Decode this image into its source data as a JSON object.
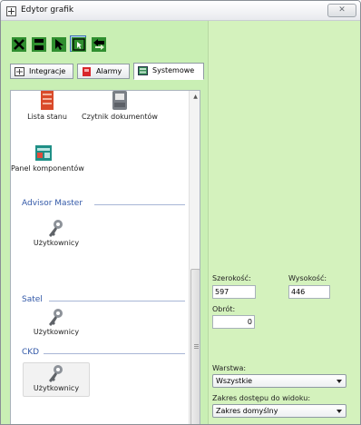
{
  "window": {
    "title": "Edytor grafik",
    "close_symbol": "✕"
  },
  "toolbar": {
    "buttons": [
      {
        "icon": "close-icon",
        "color": "#2f8f2f"
      },
      {
        "icon": "save-icon",
        "color": "#2f8f2f"
      },
      {
        "icon": "pointer-icon",
        "color": "#2f8f2f"
      },
      {
        "icon": "select-area-icon",
        "color": "#2f8f2f",
        "selected": true
      },
      {
        "icon": "swap-icon",
        "color": "#2f8f2f"
      }
    ]
  },
  "tabs": [
    {
      "label": "Integracje",
      "icon": "integration-icon"
    },
    {
      "label": "Alarmy",
      "icon": "alarm-icon"
    },
    {
      "label": "Systemowe",
      "icon": "system-icon",
      "active": true
    }
  ],
  "components": {
    "top_items": [
      {
        "label": "Lista stanu",
        "icon": "status-list-icon"
      },
      {
        "label": "Czytnik dokumentów",
        "icon": "document-reader-icon"
      },
      {
        "label": "Panel komponentów",
        "icon": "component-panel-icon"
      }
    ],
    "groups": [
      {
        "title": "Advisor Master",
        "items": [
          {
            "label": "Użytkownicy",
            "icon": "users-key-icon"
          }
        ]
      },
      {
        "title": "Satel",
        "items": [
          {
            "label": "Użytkownicy",
            "icon": "users-key-icon"
          }
        ]
      },
      {
        "title": "CKD",
        "items": [
          {
            "label": "Użytkownicy",
            "icon": "users-key-icon",
            "selected": true
          }
        ]
      }
    ]
  },
  "properties": {
    "width_label": "Szerokość:",
    "width_value": "597",
    "height_label": "Wysokość:",
    "height_value": "446",
    "rotation_label": "Obrót:",
    "rotation_value": "0",
    "layer_label": "Warstwa:",
    "layer_value": "Wszystkie",
    "access_label": "Zakres dostępu do widoku:",
    "access_value": "Zakres domyślny"
  },
  "colors": {
    "left_background": "#c9efb4",
    "right_background": "#d4f2bd",
    "group_header": "#3359a8"
  }
}
